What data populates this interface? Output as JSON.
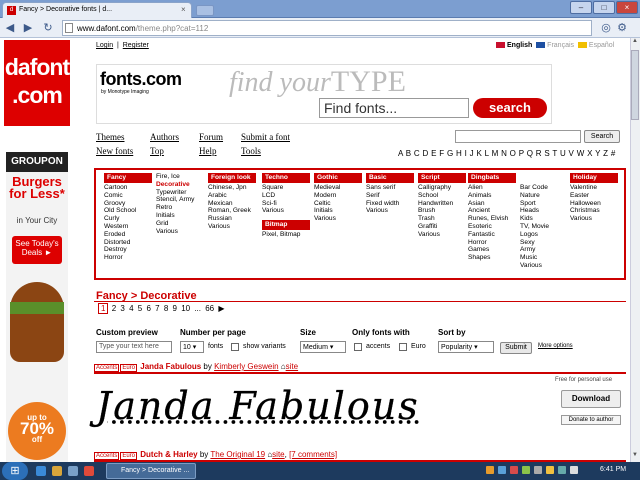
{
  "browser": {
    "tab_title": "Fancy > Decorative fonts | d...",
    "url": "www.dafont.com/theme.php?cat=112",
    "url_host": "www.dafont.com",
    "url_path": "/theme.php?cat=112"
  },
  "header": {
    "logo_line1": "dafont",
    "logo_line2": ".com",
    "login": "Login",
    "register": "Register",
    "languages": [
      "English",
      "Français",
      "Español"
    ]
  },
  "ad": {
    "brand": "fonts.com",
    "brand_sub": "by Monotype Imaging",
    "tagline": "find your",
    "tagline_word": "TYPE",
    "search_placeholder": "Find fonts...",
    "search_button": "search"
  },
  "nav": {
    "row1": [
      "Themes",
      "Authors",
      "Forum",
      "Submit a font"
    ],
    "row2": [
      "New fonts",
      "Top",
      "Help",
      "Tools"
    ],
    "search_button": "Search",
    "alphabet": "A B C D E F G H I J K L M N O P Q R S T U V W X Y Z #"
  },
  "side_ad": {
    "brand": "GROUPON",
    "headline": "Burgers for Less*",
    "city": "in Your City",
    "cta": "See Today's Deals ►",
    "discount_prefix": "up to",
    "discount": "70%",
    "discount_suffix": "off"
  },
  "categories": [
    {
      "title": "Fancy",
      "items": [
        "Cartoon",
        "Comic",
        "Groovy",
        "Old School",
        "Curly",
        "Western",
        "Eroded",
        "Distorted",
        "Destroy",
        "Horror"
      ]
    },
    {
      "title": "",
      "items": [
        "Fire, Ice",
        "Decorative",
        "Typewriter",
        "Stencil, Army",
        "Retro",
        "Initials",
        "Grid",
        "Various"
      ],
      "selected": "Decorative"
    },
    {
      "title": "Foreign look",
      "items": [
        "Chinese, Jpn",
        "Arabic",
        "Mexican",
        "Roman, Greek",
        "Russian",
        "Various"
      ]
    },
    {
      "title": "Techno",
      "items": [
        "Square",
        "LCD",
        "Sci-fi",
        "Various"
      ],
      "title2": "Bitmap",
      "items2": [
        "Pixel, Bitmap"
      ]
    },
    {
      "title": "Gothic",
      "items": [
        "Medieval",
        "Modern",
        "Celtic",
        "Initials",
        "Various"
      ]
    },
    {
      "title": "Basic",
      "items": [
        "Sans serif",
        "Serif",
        "Fixed width",
        "Various"
      ]
    },
    {
      "title": "Script",
      "items": [
        "Calligraphy",
        "School",
        "Handwritten",
        "Brush",
        "Trash",
        "Graffiti",
        "Various"
      ]
    },
    {
      "title": "Dingbats",
      "items": [
        "Alien",
        "Animals",
        "Asian",
        "Ancient",
        "Runes, Elvish",
        "Esoteric",
        "Fantastic",
        "Horror",
        "Games",
        "Shapes"
      ]
    },
    {
      "title": "",
      "items": [
        "Bar Code",
        "Nature",
        "Sport",
        "Heads",
        "Kids",
        "TV, Movie",
        "Logos",
        "Sexy",
        "Army",
        "Music",
        "Various"
      ]
    },
    {
      "title": "Holiday",
      "items": [
        "Valentine",
        "Easter",
        "Halloween",
        "Christmas",
        "Various"
      ]
    }
  ],
  "breadcrumb": "Fancy > Decorative",
  "pagination": {
    "current": "1",
    "pages": [
      "2",
      "3",
      "4",
      "5",
      "6",
      "7",
      "8",
      "9",
      "10"
    ],
    "ellipsis": "...",
    "last": "66",
    "next": "▶"
  },
  "options": {
    "custom_preview_label": "Custom preview",
    "custom_preview_placeholder": "Type your text here",
    "number_label": "Number per page",
    "number_value": "10",
    "fonts_word": "fonts",
    "show_variants": "show variants",
    "size_label": "Size",
    "size_value": "Medium",
    "only_label": "Only fonts with",
    "accents": "accents",
    "euro": "Euro",
    "sort_label": "Sort by",
    "sort_value": "Popularity",
    "submit": "Submit",
    "more_options": "More options"
  },
  "font1": {
    "tags": [
      "Accents",
      "Euro"
    ],
    "name": "Janda Fabulous",
    "by": "by",
    "author": "Kimberly Geswein",
    "site": "site",
    "license": "Free for personal use",
    "download": "Download",
    "donate": "Donate to author",
    "preview": "Janda Fabulous"
  },
  "font2": {
    "tags": [
      "Accents",
      "Euro"
    ],
    "name": "Dutch & Harley",
    "by": "by",
    "author": "The Original 19",
    "site": "site",
    "comments": "[7 comments]"
  },
  "taskbar": {
    "task_label": "Fancy > Decorative ...",
    "time": "6:41 PM"
  }
}
